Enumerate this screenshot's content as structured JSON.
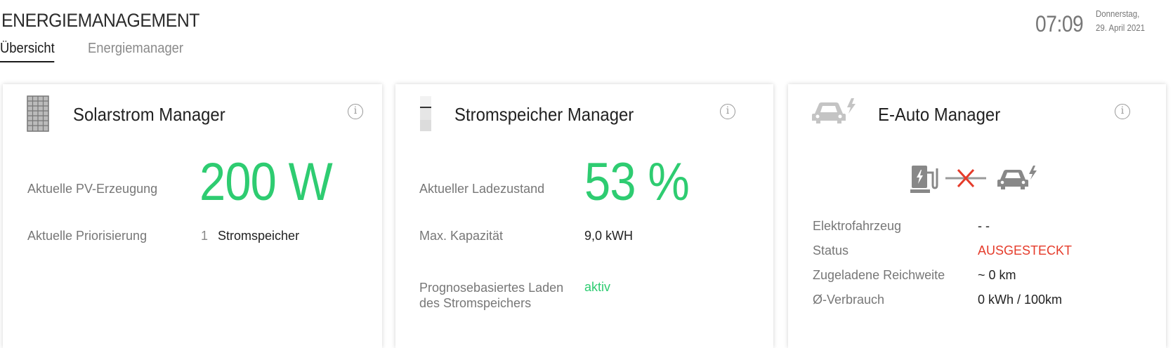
{
  "header": {
    "title": "ENERGIEMANAGEMENT",
    "time": "07:09",
    "date_line1": "Donnerstag,",
    "date_line2": "29. April 2021"
  },
  "tabs": [
    {
      "label": "Übersicht",
      "active": true
    },
    {
      "label": "Energiemanager",
      "active": false
    }
  ],
  "solar": {
    "title": "Solarstrom Manager",
    "icon": "solar-panel-icon",
    "pv_label": "Aktuelle PV-Erzeugung",
    "pv_value": "200 W",
    "prio_label": "Aktuelle Priorisierung",
    "prio_number": "1",
    "prio_value": "Stromspeicher"
  },
  "storage": {
    "title": "Stromspeicher Manager",
    "icon": "battery-icon",
    "soc_label": "Aktueller Ladezustand",
    "soc_value": "53 %",
    "capacity_label": "Max. Kapazität",
    "capacity_value": "9,0 kWH",
    "forecast_label": "Prognosebasiertes Laden des Stromspeichers",
    "forecast_value": "aktiv"
  },
  "ev": {
    "title": "E-Auto Manager",
    "icon": "electric-car-icon",
    "vehicle_label": "Elektrofahrzeug",
    "vehicle_value": "- -",
    "status_label": "Status",
    "status_value": "AUSGESTECKT",
    "range_label": "Zugeladene Reichweite",
    "range_value": "~ 0 km",
    "consumption_label": "Ø-Verbrauch",
    "consumption_value": "0 kWh / 100km"
  },
  "colors": {
    "accent_green": "#2ecc71",
    "status_red": "#e53b2a",
    "icon_gray": "#9a9a9a"
  }
}
